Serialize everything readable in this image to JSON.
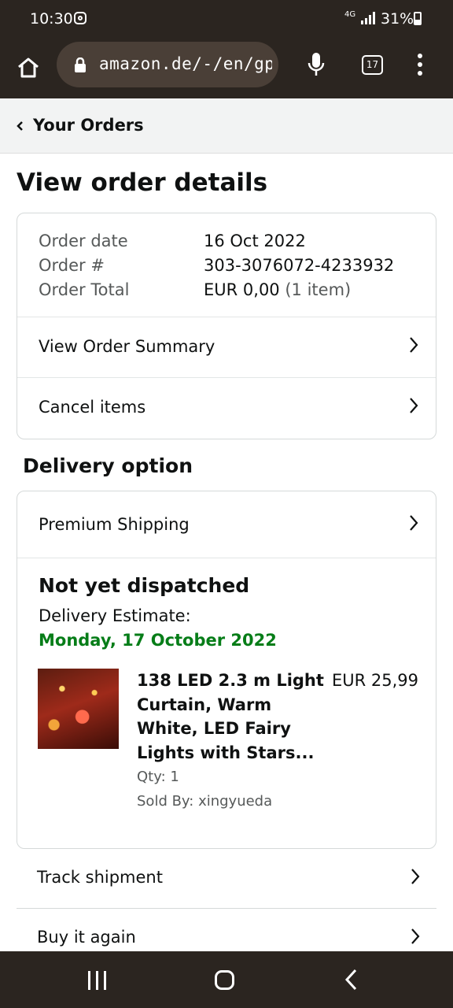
{
  "status_bar": {
    "time": "10:30",
    "network": "4G",
    "battery": "31%",
    "icons": [
      "instagram-icon",
      "signal-icon",
      "battery-icon"
    ]
  },
  "browser": {
    "url": "amazon.de/-/en/gp/",
    "tab_count": "17",
    "icons": [
      "home-icon",
      "lock-icon",
      "mic-icon",
      "tabs-icon",
      "more-icon"
    ]
  },
  "breadcrumb": {
    "label": "Your Orders"
  },
  "page": {
    "title": "View order details"
  },
  "order": {
    "rows": [
      {
        "key": "Order date",
        "value": "16 Oct 2022"
      },
      {
        "key": "Order #",
        "value": "303-3076072-4233932"
      },
      {
        "key": "Order Total",
        "value": "EUR 0,00",
        "extra": "(1 item)"
      }
    ],
    "links": [
      "View Order Summary",
      "Cancel items"
    ]
  },
  "delivery": {
    "section_title": "Delivery option",
    "option": "Premium Shipping",
    "status": "Not yet dispatched",
    "estimate_label": "Delivery Estimate:",
    "estimate_date": "Monday, 17 October 2022",
    "accent_color": "#067d18"
  },
  "product": {
    "title": "138 LED 2.3 m Light Curtain, Warm White, LED Fairy Lights with Stars...",
    "price": "EUR 25,99",
    "qty": "Qty: 1",
    "seller": "Sold By: xingyueda"
  },
  "actions": [
    "Track shipment",
    "Buy it again"
  ]
}
